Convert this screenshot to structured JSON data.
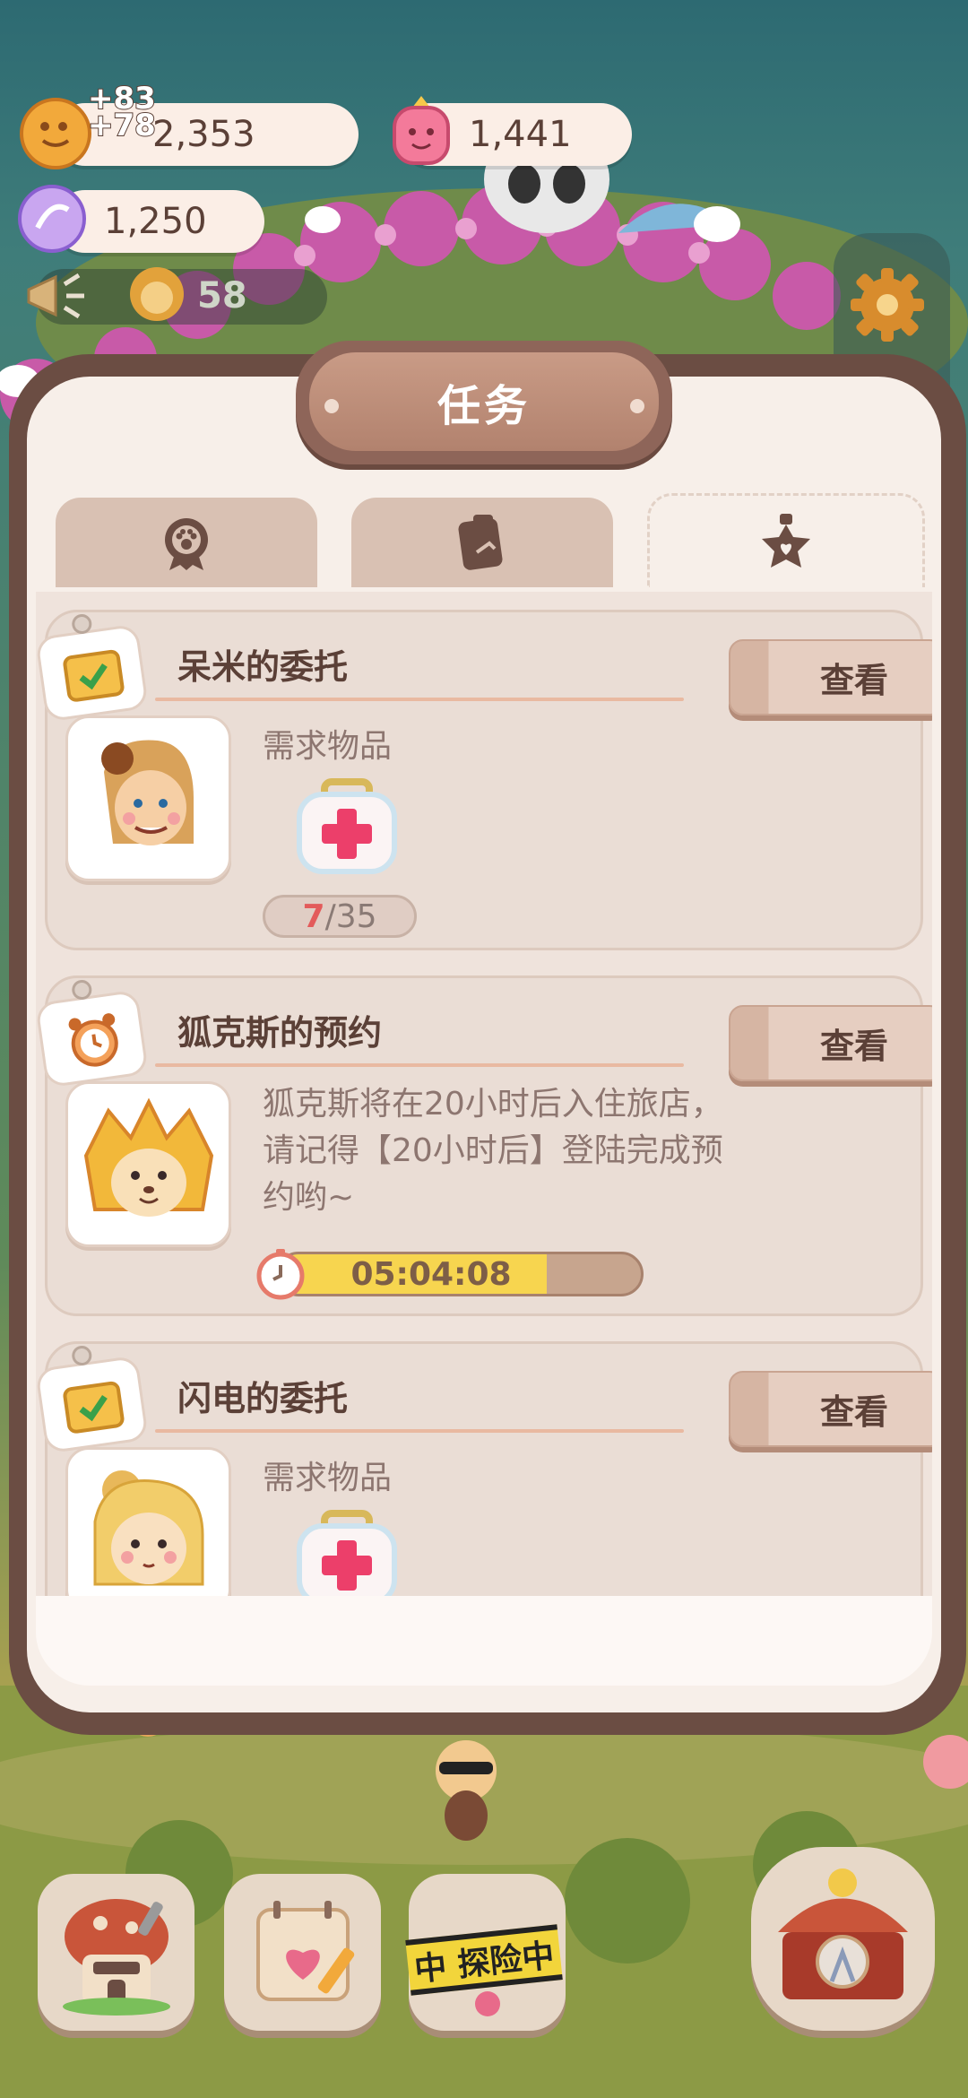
{
  "hud": {
    "cookies": "2,353",
    "cookies_gain_1": "+83",
    "cookies_gain_2": "+78",
    "gems": "1,441",
    "crystals": "1,250",
    "notice_count": "58"
  },
  "panel": {
    "title": "任务",
    "tabs": [
      {
        "icon": "paw-medal-icon",
        "active": false
      },
      {
        "icon": "notes-icon",
        "active": false
      },
      {
        "icon": "star-bottle-icon",
        "active": true
      }
    ]
  },
  "tasks": [
    {
      "title": "呆米的委托",
      "badge_icon": "check-note-icon",
      "button": "查看",
      "req_label": "需求物品",
      "item_icon": "first-aid-kit-icon",
      "progress_current": "7",
      "progress_total": "/35"
    },
    {
      "title": "狐克斯的预约",
      "badge_icon": "alarm-clock-icon",
      "button": "查看",
      "description": "狐克斯将在20小时后入住旅店，请记得【20小时后】登陆完成预约哟~",
      "timer": "05:04:08",
      "timer_fraction": 0.74
    },
    {
      "title": "闪电的委托",
      "badge_icon": "check-note-icon",
      "button": "查看",
      "req_label": "需求物品",
      "item_icon": "first-aid-kit-icon"
    }
  ],
  "bottom_bar": {
    "explore_tape": "中 探险中"
  },
  "colors": {
    "panel_bg": "#f7efe9",
    "panel_border": "#6b4d43",
    "accent_red": "#e35b5b",
    "timer_fill": "#f7d54f"
  }
}
